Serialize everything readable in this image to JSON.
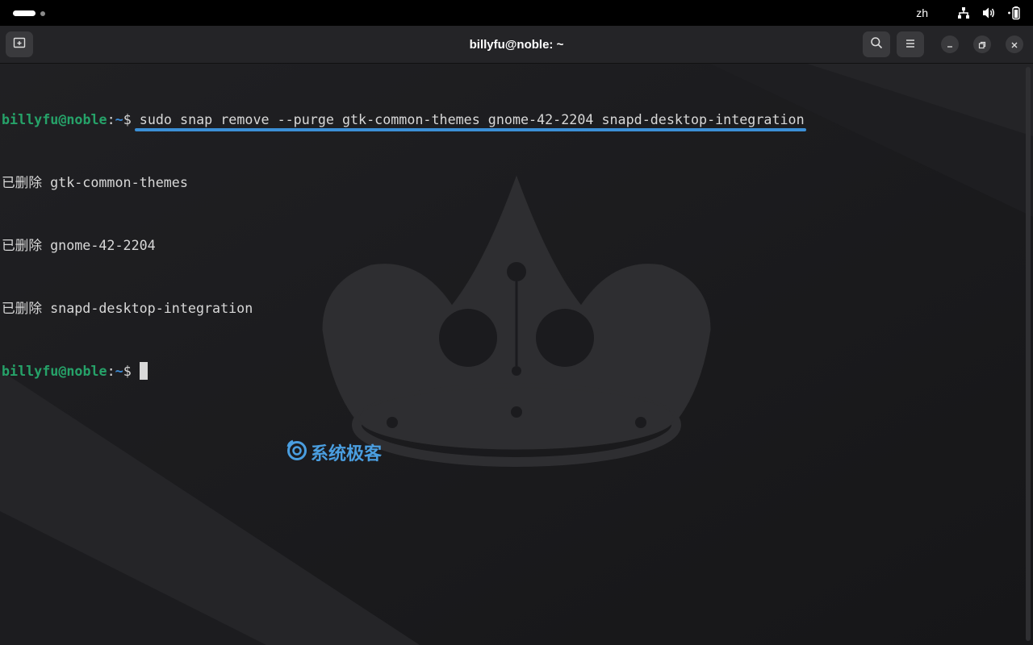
{
  "topbar": {
    "input_method": "zh",
    "icons": [
      "network-icon",
      "volume-icon",
      "battery-icon"
    ]
  },
  "window": {
    "title": "billyfu@noble: ~",
    "buttons": {
      "new_tab": "new-tab-icon",
      "search": "search-icon",
      "menu": "hamburger-menu-icon",
      "minimize": "minimize-icon",
      "maximize": "maximize-icon",
      "close": "close-icon"
    }
  },
  "terminal": {
    "prompt_user": "billyfu@noble",
    "prompt_sep": ":",
    "prompt_path": "~",
    "prompt_symbol": "$ ",
    "command": "sudo snap remove --purge gtk-common-themes gnome-42-2204 snapd-desktop-integration",
    "output": [
      "已删除 gtk-common-themes",
      "已删除 gnome-42-2204",
      "已删除 snapd-desktop-integration"
    ]
  },
  "watermark": {
    "text": "系统极客"
  },
  "colors": {
    "prompt_user": "#26a269",
    "prompt_path": "#3d8bd6",
    "accent": "#3b8fd6",
    "watermark": "#4a9ee0"
  }
}
